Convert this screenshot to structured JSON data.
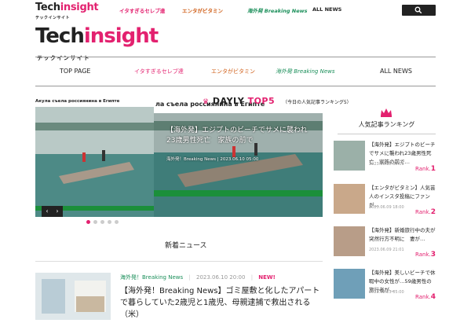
{
  "header": {
    "logo_tech": "Tech",
    "logo_insight": "insight",
    "logo_kana": "テックインサイト",
    "nav_top": [
      {
        "label": "イタすぎるセレブ達"
      },
      {
        "label": "エンタがビタミン"
      },
      {
        "label": "海外発 Breaking News"
      },
      {
        "label": "ALL NEWS"
      }
    ],
    "search_icon": "search-icon"
  },
  "main_nav": [
    {
      "label": "TOP PAGE"
    },
    {
      "label": "イタすぎるセレブ達"
    },
    {
      "label": "エンタがビタミン"
    },
    {
      "label": "海外発 Breaking News"
    },
    {
      "label": "ALL NEWS"
    }
  ],
  "slider": {
    "left_caption": "Акула съела россиянина в Египте",
    "main_caption": "ла съела россиянина в Египте",
    "daily_label_a": "DAYLY ",
    "daily_label_b": "TOP5",
    "daily_sub": "（今日の人気記事ランキング5）",
    "slide_title": "【海外発】エジプトのビーチでサメに襲われ23歳男性死亡　家族の前で",
    "slide_meta": "海外発！Breaking News | 2023.06.10 05:00",
    "prev": "‹",
    "next": "›"
  },
  "section": {
    "heading": "新着ニュース"
  },
  "article": {
    "category": "海外発！Breaking News",
    "date": "2023.06.10 20:00",
    "badge": "NEW!",
    "title": "【海外発！Breaking News】ゴミ屋敷と化したアパートで暮らしていた2歳児と1歳児、母親逮捕で救出される（米）"
  },
  "ranking": {
    "heading": "人気記事ランキング",
    "items": [
      {
        "title": "【海外発】エジプトのビーチでサメに襲われ23歳男性死亡　家族の前で…",
        "date": "2023.06.10 05:00",
        "rank_prefix": "Rank.",
        "rank_num": "1",
        "thumb_color": "#9bb0a8"
      },
      {
        "title": "【エンタがビタミン】人気芸人のインスタ投稿にファンが…",
        "date": "2023.06.09 18:00",
        "rank_prefix": "Rank.",
        "rank_num": "2",
        "thumb_color": "#c9a88a"
      },
      {
        "title": "【海外発】新婚旅行中の夫が突然行方不明に　妻が…",
        "date": "2023.06.09 21:01",
        "rank_prefix": "Rank.",
        "rank_num": "3",
        "thumb_color": "#b89d88"
      },
      {
        "title": "【海外発】美しいビーチで休暇中の女性が…59歳男性の旅行者が…",
        "date": "2023.02.23 05:00",
        "rank_prefix": "Rank.",
        "rank_num": "4",
        "thumb_color": "#6f9fb8"
      }
    ]
  },
  "colors": {
    "accent": "#e3216f",
    "tv_green": "#1b8f3a"
  }
}
